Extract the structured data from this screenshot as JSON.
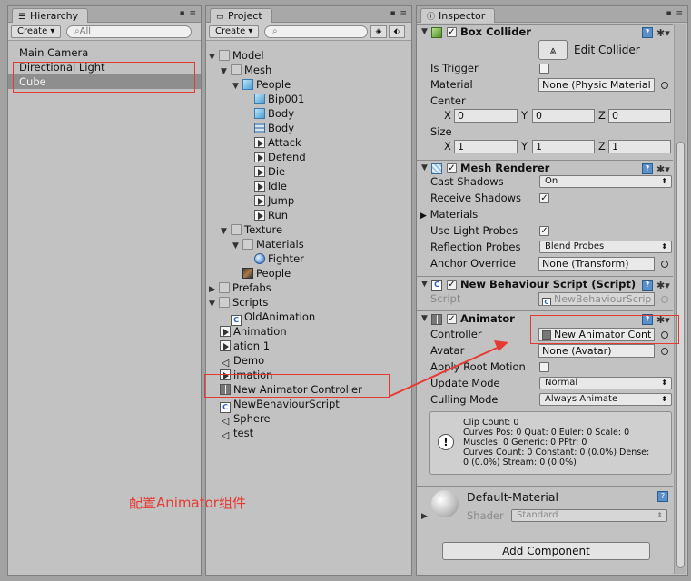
{
  "hierarchy": {
    "tab_label": "Hierarchy",
    "create_label": "Create",
    "search_placeholder": "⌕All",
    "items": [
      "Main Camera",
      "Directional Light",
      "Cube"
    ]
  },
  "project": {
    "tab_label": "Project",
    "create_label": "Create",
    "search_placeholder": "⌕",
    "tree": [
      {
        "label": "Model",
        "icon": "folder-icon",
        "depth": 0,
        "arrow": "down"
      },
      {
        "label": "Mesh",
        "icon": "folder-icon",
        "depth": 1,
        "arrow": "down"
      },
      {
        "label": "People",
        "icon": "cube-icon",
        "depth": 2,
        "arrow": "down"
      },
      {
        "label": "Bip001",
        "icon": "cube-icon",
        "depth": 3,
        "arrow": ""
      },
      {
        "label": "Body",
        "icon": "cube-icon",
        "depth": 3,
        "arrow": ""
      },
      {
        "label": "Body",
        "icon": "mesh-grid-icon",
        "depth": 3,
        "arrow": ""
      },
      {
        "label": "Attack",
        "icon": "animation-clip-icon",
        "depth": 3,
        "arrow": ""
      },
      {
        "label": "Defend",
        "icon": "animation-clip-icon",
        "depth": 3,
        "arrow": ""
      },
      {
        "label": "Die",
        "icon": "animation-clip-icon",
        "depth": 3,
        "arrow": ""
      },
      {
        "label": "Idle",
        "icon": "animation-clip-icon",
        "depth": 3,
        "arrow": ""
      },
      {
        "label": "Jump",
        "icon": "animation-clip-icon",
        "depth": 3,
        "arrow": ""
      },
      {
        "label": "Run",
        "icon": "animation-clip-icon",
        "depth": 3,
        "arrow": ""
      },
      {
        "label": "Texture",
        "icon": "folder-icon",
        "depth": 1,
        "arrow": "down"
      },
      {
        "label": "Materials",
        "icon": "folder-icon",
        "depth": 2,
        "arrow": "down"
      },
      {
        "label": "Fighter",
        "icon": "material-sphere-icon",
        "depth": 3,
        "arrow": ""
      },
      {
        "label": "People",
        "icon": "texture-icon",
        "depth": 2,
        "arrow": ""
      },
      {
        "label": "Prefabs",
        "icon": "folder-icon",
        "depth": 0,
        "arrow": "right"
      },
      {
        "label": "Scripts",
        "icon": "folder-icon",
        "depth": 0,
        "arrow": "down"
      },
      {
        "label": "OldAnimation",
        "icon": "csharp-script-icon",
        "depth": 1,
        "arrow": ""
      },
      {
        "label": "Animation",
        "icon": "animation-clip-icon",
        "depth": -1,
        "arrow": ""
      },
      {
        "label": "ation 1",
        "icon": "animation-clip-icon",
        "depth": -1,
        "arrow": ""
      },
      {
        "label": "Demo",
        "icon": "unity-scene-icon",
        "depth": -1,
        "arrow": ""
      },
      {
        "label": "imation",
        "icon": "animation-clip-icon",
        "depth": -1,
        "arrow": ""
      },
      {
        "label": "New Animator Controller",
        "icon": "animator-controller-icon",
        "depth": -1,
        "arrow": ""
      },
      {
        "label": "NewBehaviourScript",
        "icon": "csharp-script-icon",
        "depth": -1,
        "arrow": ""
      },
      {
        "label": "Sphere",
        "icon": "unity-scene-icon",
        "depth": -1,
        "arrow": ""
      },
      {
        "label": "test",
        "icon": "unity-scene-icon",
        "depth": -1,
        "arrow": ""
      }
    ]
  },
  "inspector": {
    "tab_label": "Inspector",
    "box_collider": {
      "title": "Box Collider",
      "edit_collider_label": "Edit Collider",
      "is_trigger_label": "Is Trigger",
      "material_label": "Material",
      "material_value": "None (Physic Material",
      "center_label": "Center",
      "size_label": "Size",
      "x": "X",
      "y": "Y",
      "z": "Z",
      "center": [
        "0",
        "0",
        "0"
      ],
      "size": [
        "1",
        "1",
        "1"
      ]
    },
    "mesh_renderer": {
      "title": "Mesh Renderer",
      "cast_shadows_label": "Cast Shadows",
      "cast_shadows_value": "On",
      "receive_shadows_label": "Receive Shadows",
      "materials_label": "Materials",
      "light_probes_label": "Use Light Probes",
      "reflection_probes_label": "Reflection Probes",
      "reflection_probes_value": "Blend Probes",
      "anchor_override_label": "Anchor Override",
      "anchor_override_value": "None (Transform)"
    },
    "behaviour_script": {
      "title": "New Behaviour Script (Script)",
      "script_label": "Script",
      "script_value": "NewBehaviourScrip"
    },
    "animator": {
      "title": "Animator",
      "controller_label": "Controller",
      "controller_value": "New Animator Cont",
      "avatar_label": "Avatar",
      "avatar_value": "None (Avatar)",
      "root_motion_label": "Apply Root Motion",
      "update_mode_label": "Update Mode",
      "update_mode_value": "Normal",
      "culling_mode_label": "Culling Mode",
      "culling_mode_value": "Always Animate",
      "info_lines": [
        "Clip Count: 0",
        "Curves Pos: 0 Quat: 0 Euler: 0 Scale: 0",
        "Muscles: 0 Generic: 0 PPtr: 0",
        "Curves Count: 0 Constant: 0 (0.0%) Dense:",
        "0 (0.0%) Stream: 0 (0.0%)"
      ]
    },
    "material": {
      "title": "Default-Material",
      "shader_label": "Shader",
      "shader_value": "Standard"
    },
    "add_component_label": "Add Component"
  },
  "annotation_text": "配置Animator组件",
  "colors": {
    "annotation": "#e63a32",
    "selection": "#8e8e8e"
  }
}
